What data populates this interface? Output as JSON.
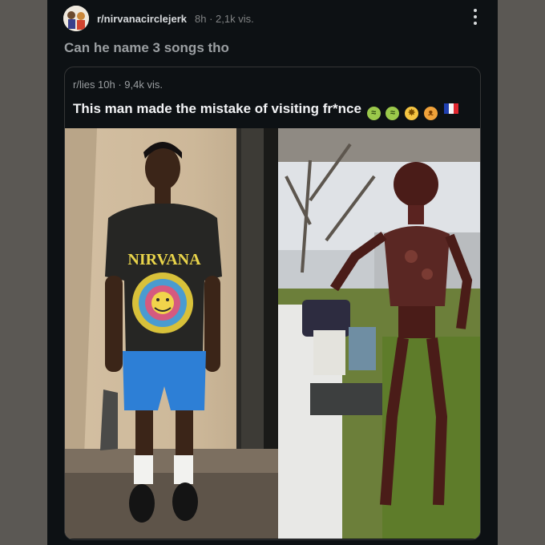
{
  "post": {
    "subreddit": "r/nirvanacirclejerk",
    "meta": "8h · 2,1k vis.",
    "title": "Can he name 3 songs tho",
    "menu_icon": "kebab-menu-icon"
  },
  "crosspost": {
    "meta": "r/lies  10h · 9,4k vis.",
    "title": "This man made the mistake of visiting fr*nce",
    "emojis": [
      "nauseated-face",
      "nauseated-face",
      "exploding-head",
      "pouting-cat",
      "flag-france"
    ],
    "images": {
      "left": {
        "shirt_text": "NIRVANA"
      }
    }
  },
  "colors": {
    "background": "#0d1114",
    "outer": "#5b5854",
    "text_primary": "#d7dadc",
    "text_secondary": "#818384",
    "border": "#343536"
  }
}
